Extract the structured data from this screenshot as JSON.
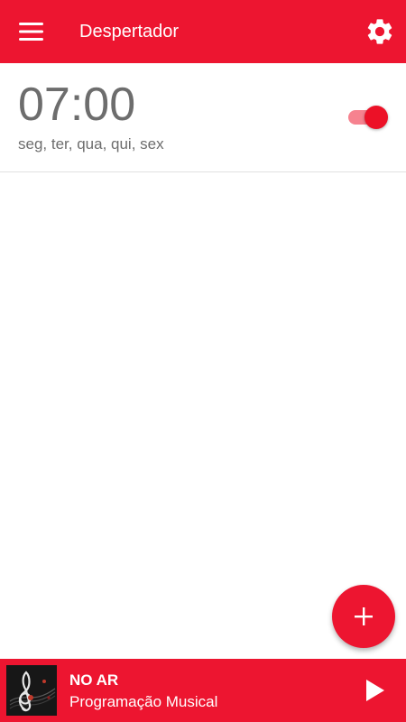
{
  "appbar": {
    "title": "Despertador",
    "menu_icon": "hamburger-menu-icon",
    "settings_icon": "gear-icon"
  },
  "alarms": [
    {
      "time": "07:00",
      "days": "seg, ter, qua, qui, sex",
      "enabled": true
    }
  ],
  "fab": {
    "icon": "plus-icon"
  },
  "player": {
    "title": "NO AR",
    "subtitle": "Programação Musical",
    "cover_icon": "treble-clef-icon",
    "play_icon": "play-icon"
  },
  "colors": {
    "primary": "#ed1530",
    "toggle_track": "#f6828f",
    "text_secondary": "#6d6d6d",
    "divider": "#e0e0e0"
  }
}
